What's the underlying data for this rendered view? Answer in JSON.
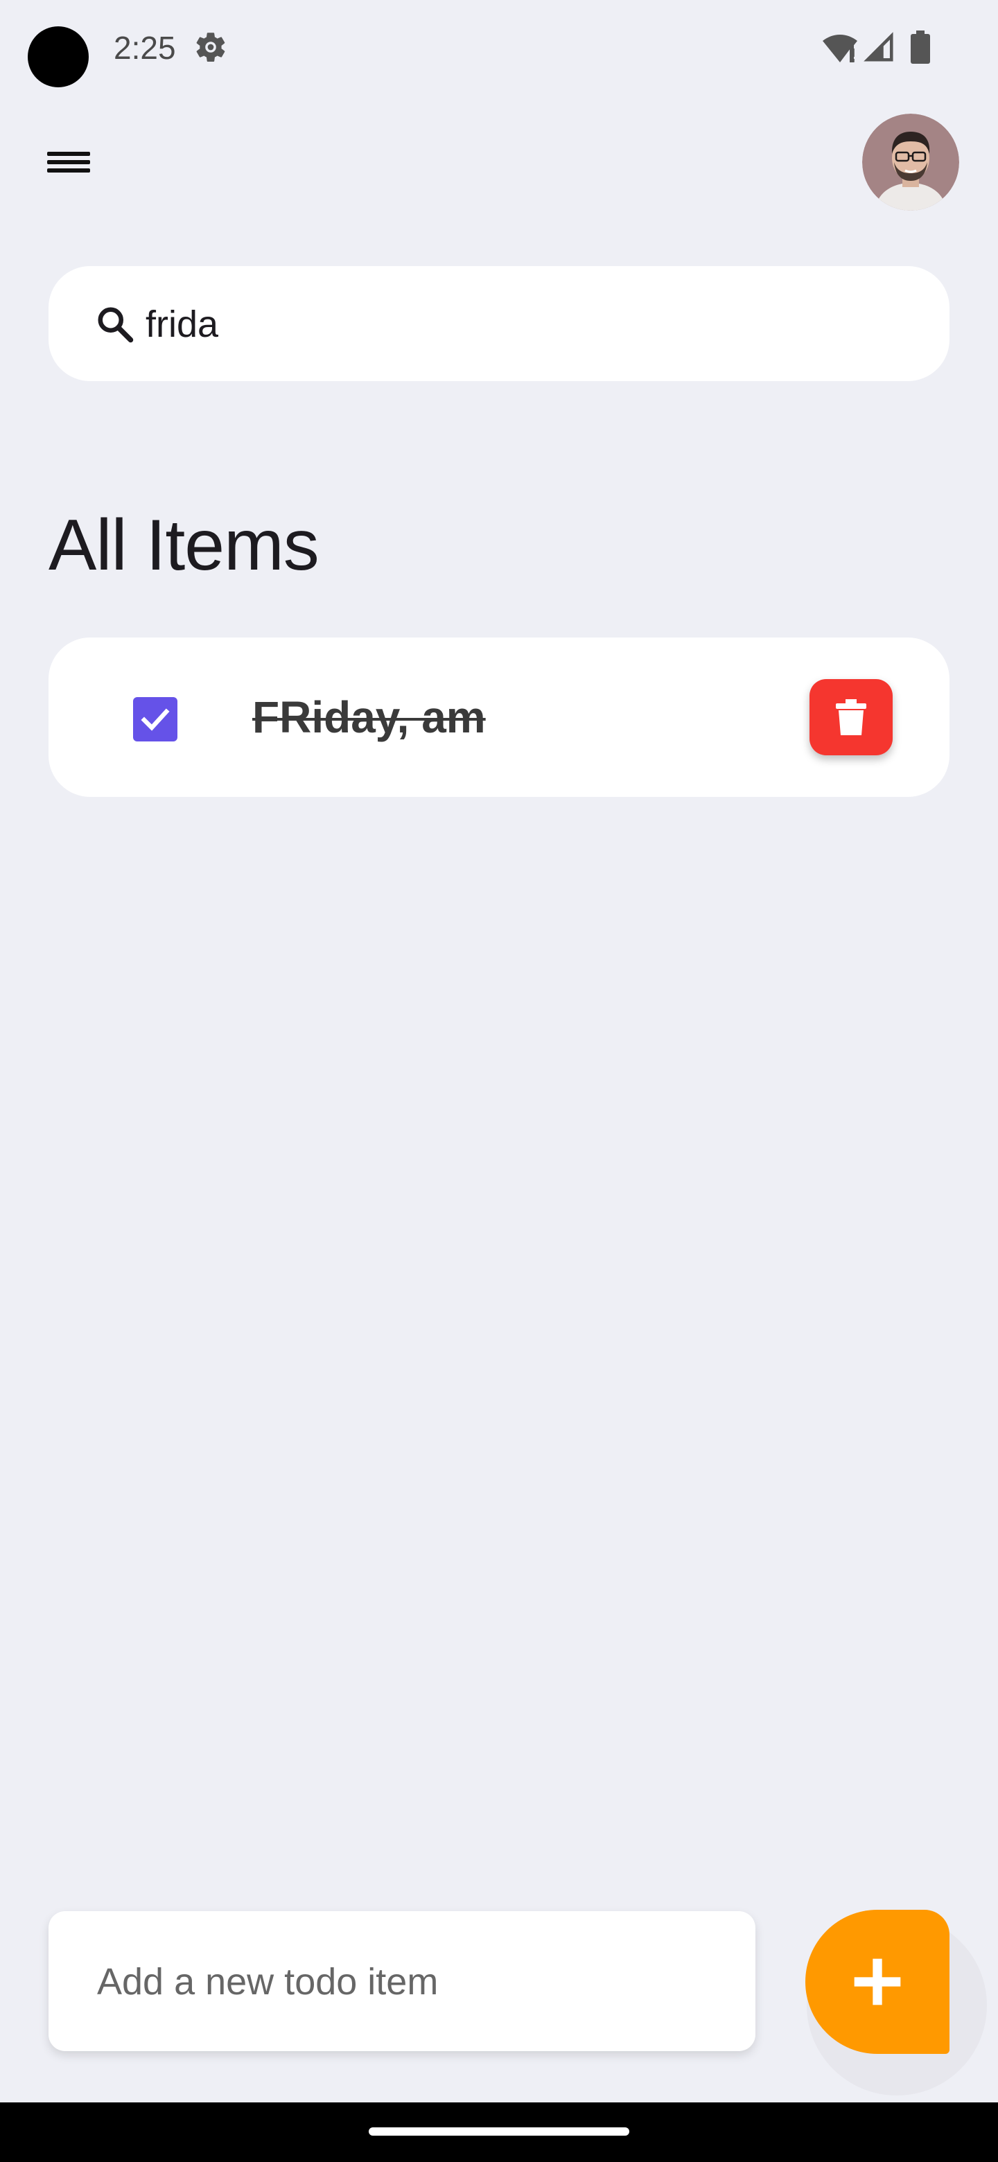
{
  "status_bar": {
    "time": "2:25",
    "icons": [
      "camera-cutout",
      "settings-icon",
      "wifi-icon",
      "signal-icon",
      "battery-icon"
    ]
  },
  "header": {
    "menu_icon": "hamburger-menu-icon",
    "avatar": "user-avatar"
  },
  "search": {
    "value": "frida",
    "icon": "search-icon"
  },
  "section": {
    "title": "All Items"
  },
  "todos": [
    {
      "text": "FRiday, am",
      "checked": true,
      "completed": true
    }
  ],
  "add_todo": {
    "placeholder": "Add a new todo item",
    "value": "",
    "fab_icon": "plus-icon"
  },
  "colors": {
    "background": "#EEEFF5",
    "card": "#FFFFFF",
    "checkbox": "#6552E8",
    "delete": "#F5362F",
    "fab": "#FF9900"
  }
}
